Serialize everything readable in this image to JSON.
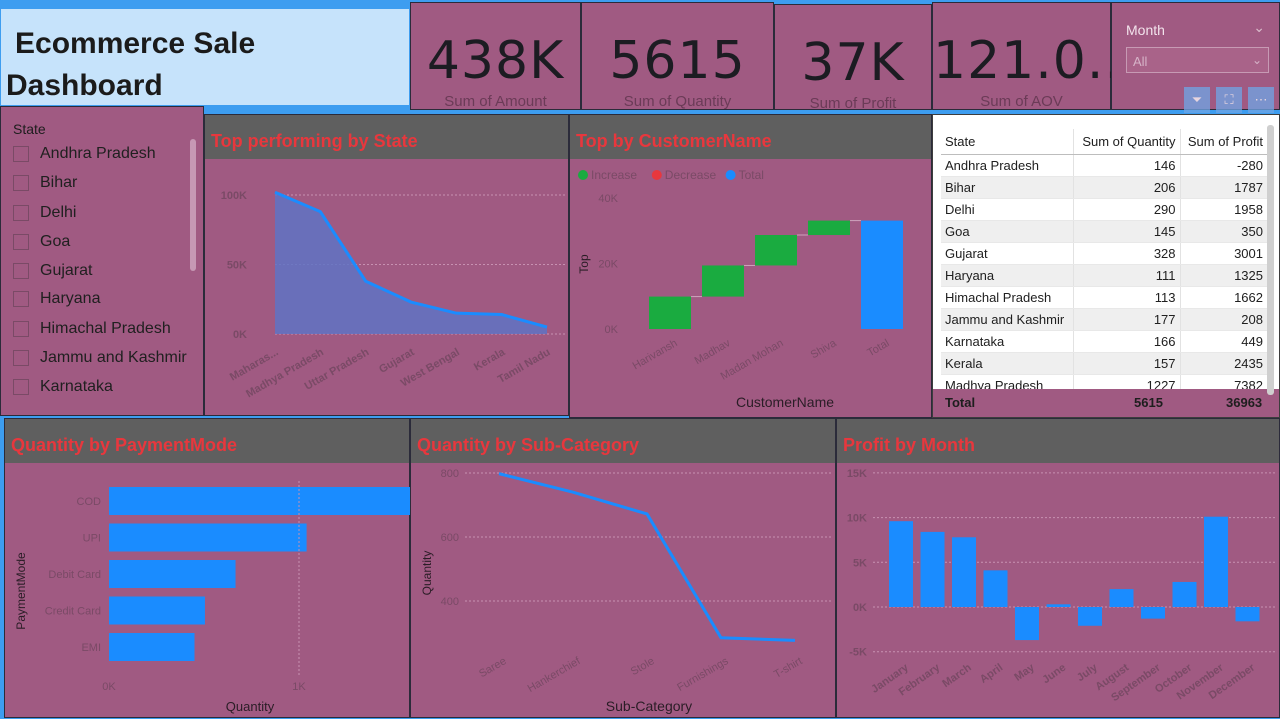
{
  "header": {
    "title_line1": "Ecommerce Sale",
    "title_line2": "Dashboard"
  },
  "kpis": [
    {
      "value": "438K",
      "label": "Sum of Amount"
    },
    {
      "value": "5615",
      "label": "Sum of Quantity"
    },
    {
      "value": "37K",
      "label": "Sum of Profit"
    },
    {
      "value": "121.0...",
      "label": "Sum of AOV"
    }
  ],
  "month_filter": {
    "label": "Month",
    "value": "All"
  },
  "state_slicer": {
    "header": "State",
    "items": [
      "Andhra Pradesh",
      "Bihar",
      "Delhi",
      "Goa",
      "Gujarat",
      "Haryana",
      "Himachal Pradesh",
      "Jammu and Kashmir",
      "Karnataka"
    ]
  },
  "visual_titles": {
    "state": "Top performing by State",
    "customer": "Top by CustomerName",
    "payment": "Quantity by PaymentMode",
    "subcategory": "Quantity by Sub-Category",
    "month": "Profit by Month"
  },
  "table": {
    "columns": [
      "State",
      "Sum of Quantity",
      "Sum of Profit"
    ],
    "rows": [
      [
        "Andhra Pradesh",
        "146",
        "-280"
      ],
      [
        "Bihar",
        "206",
        "1787"
      ],
      [
        "Delhi",
        "290",
        "1958"
      ],
      [
        "Goa",
        "145",
        "350"
      ],
      [
        "Gujarat",
        "328",
        "3001"
      ],
      [
        "Haryana",
        "111",
        "1325"
      ],
      [
        "Himachal Pradesh",
        "113",
        "1662"
      ],
      [
        "Jammu and Kashmir",
        "177",
        "208"
      ],
      [
        "Karnataka",
        "166",
        "449"
      ],
      [
        "Kerala",
        "157",
        "2435"
      ],
      [
        "Madhya Pradesh",
        "1227",
        "7382"
      ]
    ],
    "total": [
      "Total",
      "5615",
      "36963"
    ]
  },
  "colors": {
    "accent": "#1a8cff",
    "increase": "#1aab40",
    "decrease": "#e8373d",
    "panel": "#a05a82",
    "title_red": "#e8373d"
  },
  "chart_data": [
    {
      "id": "state",
      "type": "area",
      "categories": [
        "Maharas...",
        "Madhya Pradesh",
        "Uttar Pradesh",
        "Gujarat",
        "West Bengal",
        "Kerala",
        "Tamil Nadu"
      ],
      "x": [
        0,
        1,
        2,
        3,
        4,
        5,
        6,
        7,
        8,
        9
      ],
      "values": [
        102000,
        88000,
        38000,
        23000,
        15000,
        14000,
        5000
      ],
      "yticks": [
        "100K",
        "50K",
        "0K"
      ],
      "ylim": [
        0,
        110000
      ]
    },
    {
      "id": "customer",
      "type": "bar",
      "subtype": "waterfall",
      "categories": [
        "Harivansh",
        "Madhav",
        "Madan Mohan",
        "Shiva",
        "Total"
      ],
      "values": [
        9900,
        9500,
        9300,
        4400,
        33100
      ],
      "legend": [
        "Increase",
        "Decrease",
        "Total"
      ],
      "ylabel": "Top",
      "xlabel": "CustomerName",
      "yticks": [
        "40K",
        "20K",
        "0K"
      ],
      "ylim": [
        0,
        40000
      ]
    },
    {
      "id": "payment",
      "type": "bar",
      "orientation": "horizontal",
      "categories": [
        "COD",
        "UPI",
        "Debit Card",
        "Credit Card",
        "EMI"
      ],
      "values": [
        2544,
        1040,
        666,
        505,
        450
      ],
      "xlabel": "Quantity",
      "ylabel": "PaymentMode",
      "xticks": [
        "0K",
        "1K"
      ],
      "xlim": [
        0,
        2000
      ]
    },
    {
      "id": "subcategory",
      "type": "line",
      "categories": [
        "Saree",
        "Hankerchief",
        "Stole",
        "Furnishings",
        "T-shirt"
      ],
      "values": [
        798,
        740,
        672,
        285,
        277
      ],
      "xlabel": "Sub-Category",
      "ylabel": "Quantity",
      "yticks": [
        "800",
        "600",
        "400"
      ],
      "ylim": [
        200,
        800
      ]
    },
    {
      "id": "month",
      "type": "bar",
      "categories": [
        "January",
        "February",
        "March",
        "April",
        "May",
        "June",
        "July",
        "August",
        "September",
        "October",
        "November",
        "December"
      ],
      "values": [
        9600,
        8400,
        7800,
        4100,
        -3700,
        300,
        -2100,
        2000,
        -1300,
        2800,
        10100,
        -1600
      ],
      "yticks": [
        "15K",
        "10K",
        "5K",
        "0K",
        "-5K"
      ],
      "ylim": [
        -5000,
        15000
      ]
    }
  ]
}
